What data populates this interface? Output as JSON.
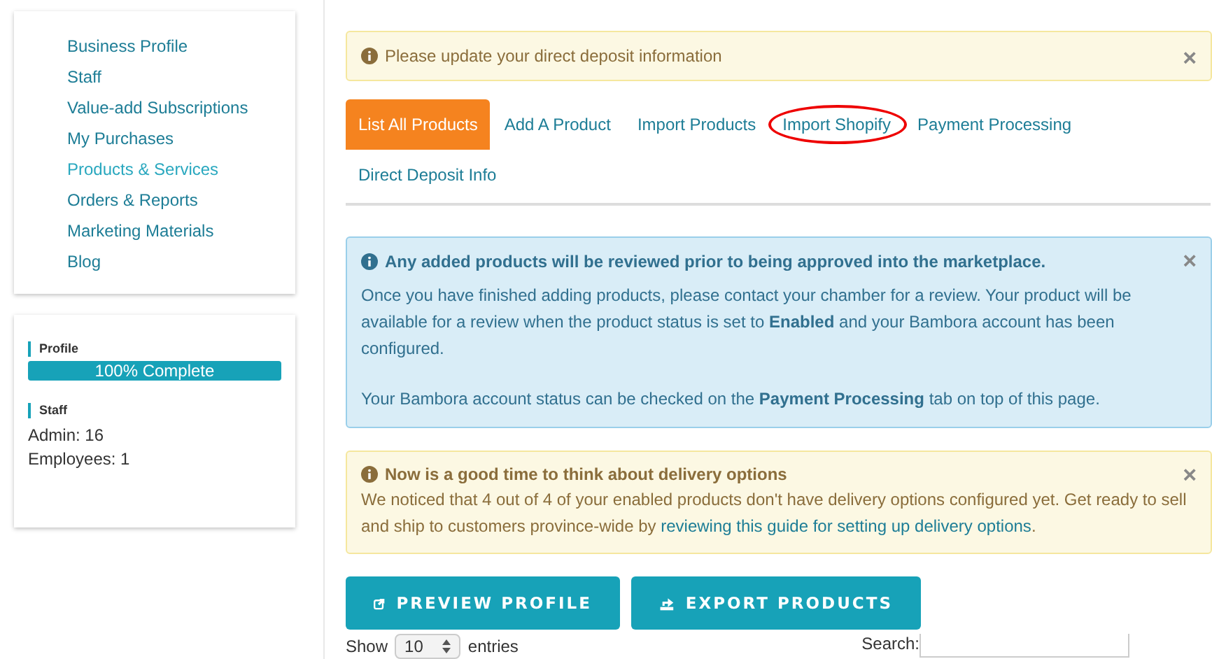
{
  "sidebar": {
    "items": [
      {
        "label": "Business Profile",
        "selected": false
      },
      {
        "label": "Staff",
        "selected": false
      },
      {
        "label": "Value-add Subscriptions",
        "selected": false
      },
      {
        "label": "My Purchases",
        "selected": false
      },
      {
        "label": "Products & Services",
        "selected": true
      },
      {
        "label": "Orders & Reports",
        "selected": false
      },
      {
        "label": "Marketing Materials",
        "selected": false
      },
      {
        "label": "Blog",
        "selected": false
      }
    ]
  },
  "stats": {
    "profile_heading": "Profile",
    "progress": {
      "level": 1,
      "label": "100% Complete"
    },
    "staff_heading": "Staff",
    "lines": [
      "Admin: 16",
      "Employees: 1"
    ]
  },
  "deposit_alert": {
    "text": "Please update your direct deposit information",
    "close": "×"
  },
  "tabs": [
    {
      "label": "List All Products",
      "selected": true,
      "circled": false
    },
    {
      "label": "Add A Product",
      "selected": false,
      "circled": false
    },
    {
      "label": "Import Products",
      "selected": false,
      "circled": false
    },
    {
      "label": "Import Shopify",
      "selected": false,
      "circled": true
    },
    {
      "label": "Payment Processing",
      "selected": false,
      "circled": false
    },
    {
      "label": "Direct Deposit Info",
      "selected": false,
      "circled": false
    }
  ],
  "review_alert": {
    "title": "Any added products will be reviewed prior to being approved into the marketplace.",
    "close": "×",
    "paragraphs": [
      "Once you have finished adding products, please contact your chamber for a review. Your product will be available for a review when the product status is set to **Enabled** and your Bambora account has been configured.",
      "Your Bambora account status can be checked on the **Payment Processing** tab on top of this page."
    ]
  },
  "delivery_alert": {
    "title": "Now is a good time to think about delivery options",
    "close": "×",
    "text": "We noticed that 4 out of 4 of your enabled products don't have delivery options configured yet. Get ready to sell and ship to customers province-wide by ",
    "link": "reviewing this guide for setting up delivery options",
    "after": "."
  },
  "buttons": [
    {
      "label": "PREVIEW PROFILE",
      "kind": "preview"
    },
    {
      "label": "EXPORT PRODUCTS",
      "kind": "export"
    }
  ],
  "table_controls": {
    "show_label": "Show",
    "entries_value": "10",
    "entries_label": "entries",
    "search_label": "Search:"
  }
}
